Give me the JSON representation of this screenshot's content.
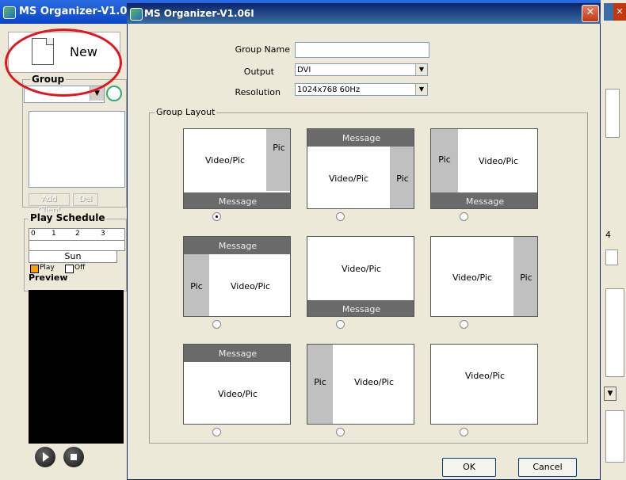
{
  "background_window": {
    "title": "MS Organizer-V1.0",
    "new_label": "New",
    "group_label": "Group",
    "buttons": [
      "Add Client",
      "Del"
    ],
    "play_schedule_label": "Play Schedule",
    "timeline_ticks": [
      "0",
      "1",
      "2",
      "3"
    ],
    "day": "Sun",
    "legend_play": "Play",
    "legend_off": "Off",
    "preview_label": "Preview",
    "right_edge_digit": "4"
  },
  "dialog": {
    "title": "MS Organizer-V1.06I",
    "close_symbol": "✕",
    "fields": {
      "group_name_label": "Group Name",
      "group_name_value": "",
      "output_label": "Output",
      "output_value": "DVI",
      "resolution_label": "Resolution",
      "resolution_value": "1024x768 60Hz"
    },
    "group_layout_label": "Group Layout",
    "layouts": [
      {
        "video": "Video/Pic",
        "pic": "Pic",
        "message": "Message",
        "selected": true
      },
      {
        "video": "Video/Pic",
        "pic": "Pic",
        "message": "Message",
        "selected": false
      },
      {
        "video": "Video/Pic",
        "pic": "Pic",
        "message": "Message",
        "selected": false
      },
      {
        "video": "Video/Pic",
        "pic": "Pic",
        "message": "Message",
        "selected": false
      },
      {
        "video": "Video/Pic",
        "message": "Message",
        "selected": false
      },
      {
        "video": "Video/Pic",
        "pic": "Pic",
        "selected": false
      },
      {
        "video": "Video/Pic",
        "message": "Message",
        "selected": false
      },
      {
        "video": "Video/Pic",
        "pic": "Pic",
        "selected": false
      },
      {
        "video": "Video/Pic",
        "selected": false
      }
    ],
    "ok_label": "OK",
    "cancel_label": "Cancel"
  },
  "colors": {
    "annotation_circle": "#e3141b",
    "message_bar": "#6a6a6a",
    "pic_zone": "#c0c0c0",
    "title_bar": "#0a246a"
  }
}
